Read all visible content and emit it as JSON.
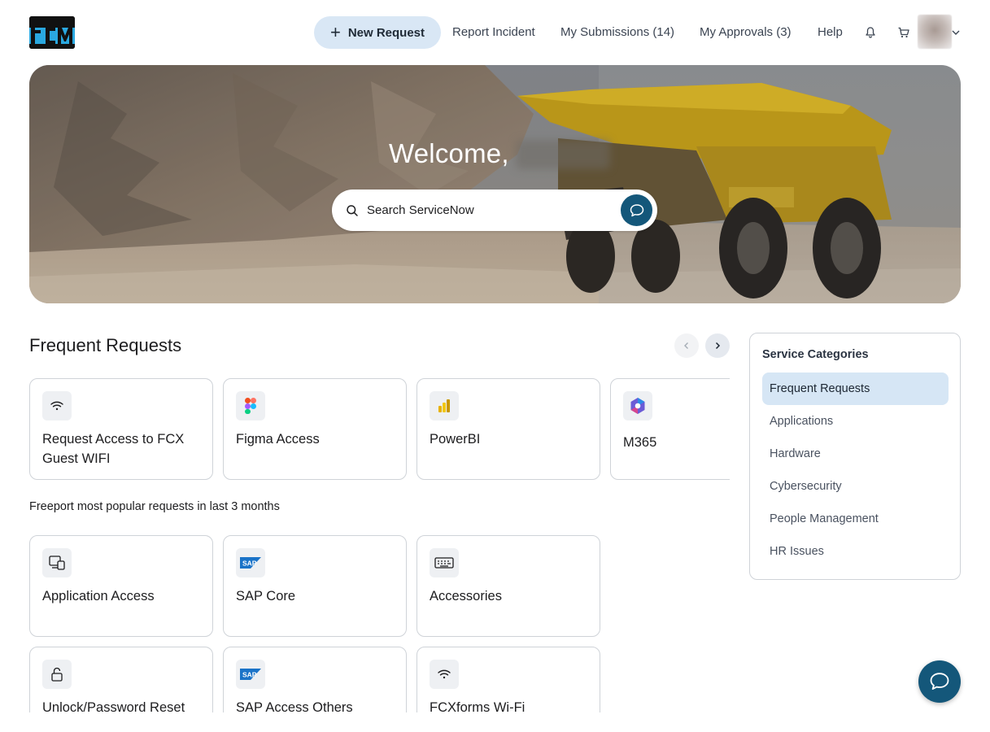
{
  "brand": {
    "logo_text": "FCX",
    "accent": "#14577a",
    "logo_blue": "#2aa8e0"
  },
  "nav": {
    "new_request": "New Request",
    "report_incident": "Report Incident",
    "my_submissions": "My Submissions (14)",
    "my_approvals": "My Approvals (3)",
    "help": "Help",
    "icons": [
      "bell-icon",
      "cart-icon",
      "chevron-down-icon"
    ]
  },
  "hero": {
    "welcome": "Welcome,",
    "search_placeholder": "Search ServiceNow"
  },
  "frequent": {
    "title": "Frequent Requests",
    "cards": [
      {
        "label": "Request Access to FCX Guest WIFI",
        "icon": "wifi-icon"
      },
      {
        "label": "Figma Access",
        "icon": "figma-icon"
      },
      {
        "label": "PowerBI",
        "icon": "powerbi-icon"
      },
      {
        "label": "M365",
        "icon": "m365-icon"
      }
    ]
  },
  "popular": {
    "label": "Freeport most popular requests in last 3 months",
    "cards": [
      {
        "label": "Application Access",
        "icon": "app-access-icon"
      },
      {
        "label": "SAP Core",
        "icon": "sap-icon"
      },
      {
        "label": "Accessories",
        "icon": "keyboard-icon"
      },
      {
        "label": "Unlock/Password Reset",
        "icon": "lock-icon"
      },
      {
        "label": "SAP Access Others",
        "icon": "sap-icon"
      },
      {
        "label": "FCXforms Wi-Fi",
        "icon": "wifi-icon"
      }
    ]
  },
  "categories": {
    "title": "Service Categories",
    "items": [
      {
        "label": "Frequent Requests",
        "active": true
      },
      {
        "label": "Applications"
      },
      {
        "label": "Hardware"
      },
      {
        "label": "Cybersecurity"
      },
      {
        "label": "People Management"
      },
      {
        "label": "HR Issues"
      }
    ]
  }
}
